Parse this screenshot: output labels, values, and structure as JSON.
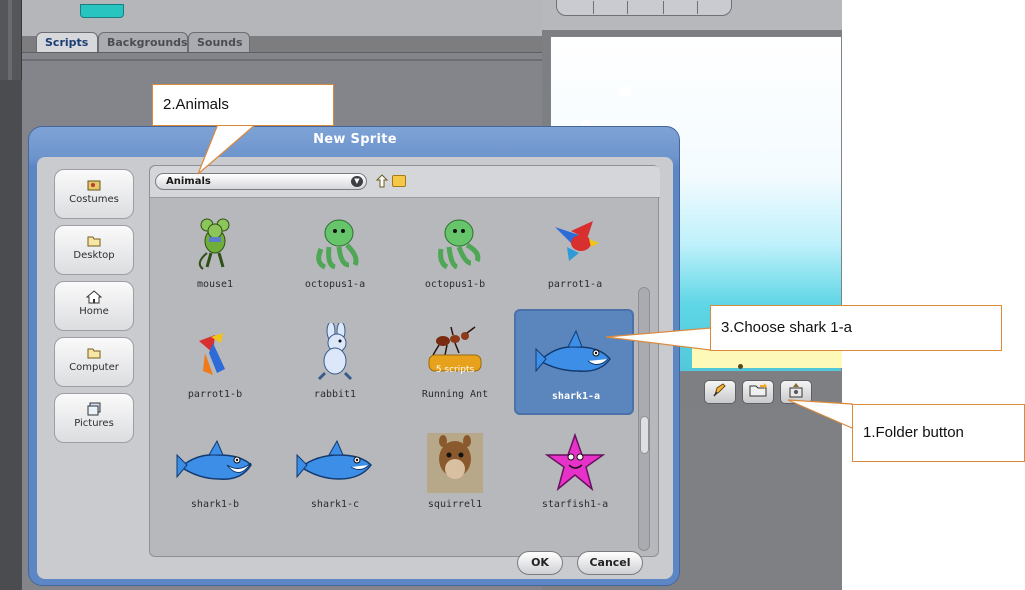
{
  "app": {
    "tabs": [
      {
        "label": "Scripts",
        "active": true
      },
      {
        "label": "Backgrounds",
        "active": false
      },
      {
        "label": "Sounds",
        "active": false
      }
    ],
    "sprite_buttons": [
      {
        "name": "paint-new-sprite-icon",
        "glyph": "✎"
      },
      {
        "name": "folder-icon",
        "glyph": "📂"
      },
      {
        "name": "surprise-sprite-icon",
        "glyph": "?"
      }
    ]
  },
  "dialog": {
    "title": "New Sprite",
    "nav": [
      {
        "label": "Costumes",
        "icon": "costumes-icon"
      },
      {
        "label": "Desktop",
        "icon": "folder-icon"
      },
      {
        "label": "Home",
        "icon": "home-icon"
      },
      {
        "label": "Computer",
        "icon": "folder-icon"
      },
      {
        "label": "Pictures",
        "icon": "pictures-icon"
      }
    ],
    "folder_dropdown": "Animals",
    "items": [
      {
        "name": "mouse1",
        "selected": false
      },
      {
        "name": "octopus1-a",
        "selected": false
      },
      {
        "name": "octopus1-b",
        "selected": false
      },
      {
        "name": "parrot1-a",
        "selected": false
      },
      {
        "name": "parrot1-b",
        "selected": false
      },
      {
        "name": "rabbit1",
        "selected": false
      },
      {
        "name": "Running Ant",
        "selected": false,
        "badge": "5 scripts"
      },
      {
        "name": "shark1-a",
        "selected": true
      },
      {
        "name": "shark1-b",
        "selected": false
      },
      {
        "name": "shark1-c",
        "selected": false
      },
      {
        "name": "squirrel1",
        "selected": false
      },
      {
        "name": "starfish1-a",
        "selected": false
      }
    ],
    "ok_label": "OK",
    "cancel_label": "Cancel"
  },
  "callouts": {
    "animals": "2.Animals",
    "choose_shark": "3.Choose shark 1-a",
    "folder_button": "1.Folder button"
  },
  "colors": {
    "dialog_title_bar": "#6d94cc",
    "selection": "#5b86bd",
    "callout_border": "#d98a3d"
  }
}
